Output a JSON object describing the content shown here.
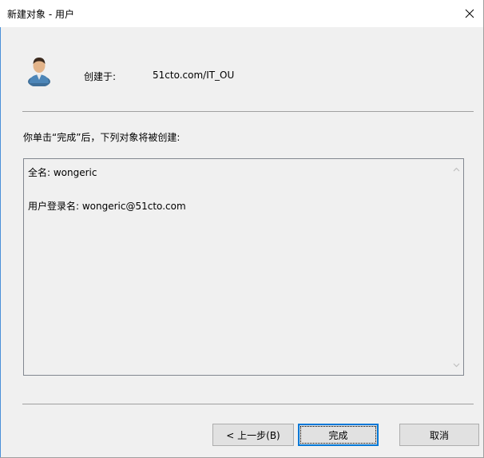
{
  "window": {
    "title": "新建对象 - 用户",
    "close_icon": "close-icon"
  },
  "header": {
    "icon": "user-icon",
    "created_in_label": "创建于:",
    "created_in_value": "51cto.com/IT_OU"
  },
  "instruction": "你单击“完成”后，下列对象将被创建:",
  "summary": {
    "lines": [
      "全名: wongeric",
      "用户登录名: wongeric@51cto.com"
    ]
  },
  "buttons": {
    "back": "< 上一步(B)",
    "finish": "完成",
    "cancel": "取消"
  },
  "colors": {
    "accent": "#0078d7",
    "background": "#f0f0f0",
    "titlebar": "#ffffff"
  }
}
